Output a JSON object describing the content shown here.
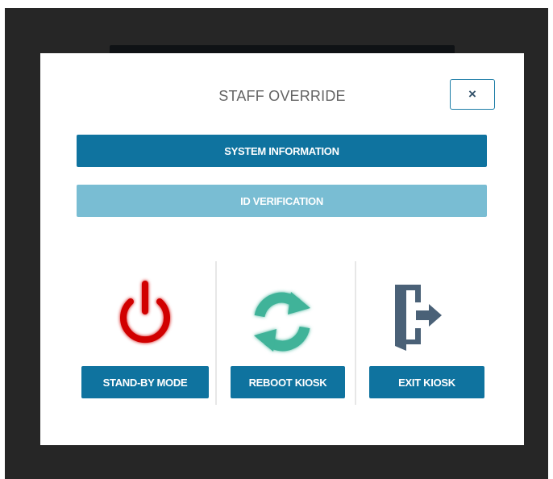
{
  "dialog": {
    "title": "STAFF OVERRIDE",
    "close_label": "×"
  },
  "buttons": {
    "system_information": "SYSTEM INFORMATION",
    "id_verification": "ID VERIFICATION"
  },
  "actions": [
    {
      "label": "STAND-BY MODE",
      "icon": "power-icon",
      "color": "#d10000"
    },
    {
      "label": "REBOOT KIOSK",
      "icon": "refresh-icon",
      "color": "#3fb399"
    },
    {
      "label": "EXIT KIOSK",
      "icon": "exit-door-icon",
      "color": "#4a6177"
    }
  ],
  "colors": {
    "primary": "#0f739f",
    "primary_light": "#79bdd3",
    "backdrop": "#262626"
  }
}
